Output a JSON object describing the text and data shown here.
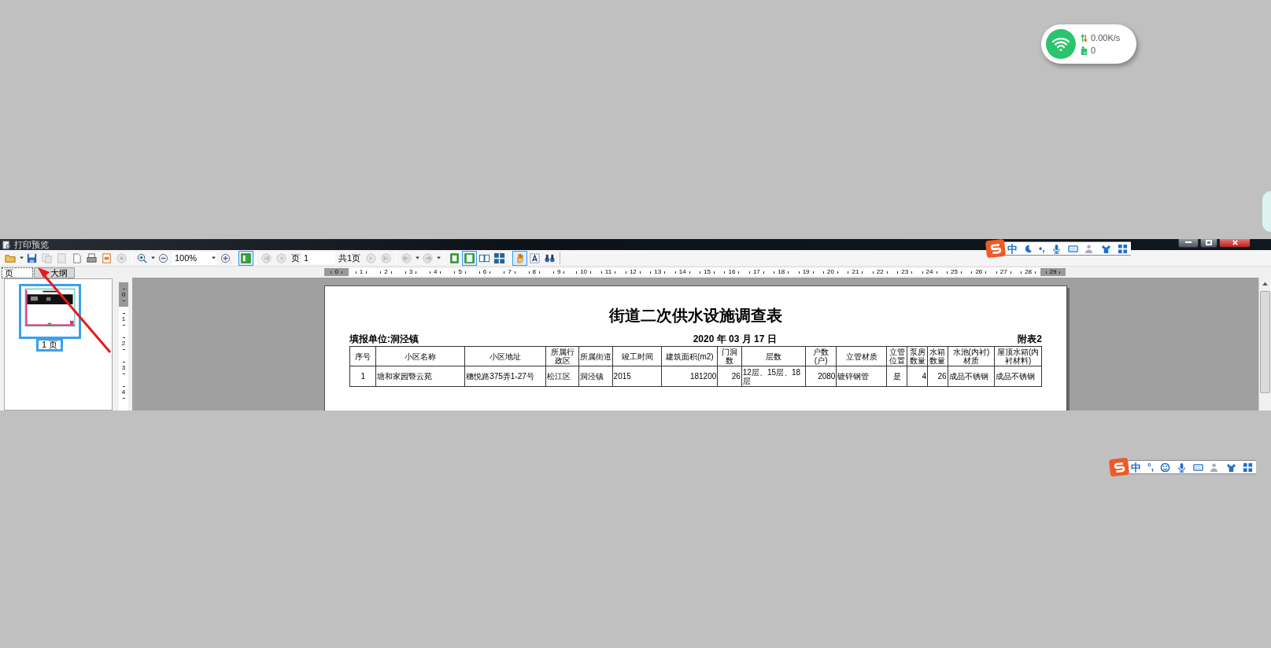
{
  "network_widget": {
    "speed": "0.00K/s",
    "count": "0"
  },
  "window": {
    "title": "打印预览"
  },
  "toolbar": {
    "zoom": "100%",
    "page_label": "页",
    "page_number": "1",
    "page_total": "共1页",
    "thumbnails_on": true,
    "view_modes": [
      {
        "selected": false
      },
      {
        "selected": true
      },
      {
        "selected": false
      },
      {
        "selected": false
      }
    ],
    "tools": [
      {
        "kind": "hand",
        "selected": true
      },
      {
        "kind": "text",
        "selected": false
      },
      {
        "kind": "find",
        "selected": false
      }
    ]
  },
  "side_tabs": [
    {
      "label": "页",
      "selected": true
    },
    {
      "label": "大纲",
      "selected": false
    }
  ],
  "thumbnails": [
    {
      "caption": "1 页",
      "selected": true
    }
  ],
  "ruler": {
    "horizontal": [
      "0",
      "1",
      "2",
      "3",
      "4",
      "5",
      "6",
      "7",
      "8",
      "9",
      "10",
      "11",
      "12",
      "13",
      "14",
      "15",
      "16",
      "17",
      "18",
      "19",
      "20",
      "21",
      "22",
      "23",
      "24",
      "25",
      "26",
      "27",
      "28",
      "29"
    ],
    "vertical": [
      "0",
      "1",
      "2",
      "3",
      "4"
    ]
  },
  "document": {
    "title": "街道二次供水设施调查表",
    "unit": "填报单位:洞泾镇",
    "date": "2020 年 03 月 17 日",
    "appendix": "附表2",
    "columns": [
      "序号",
      "小区名称",
      "小区地址",
      "所属行政区",
      "所属街道",
      "竣工时间",
      "建筑面积(m2)",
      "门洞数",
      "层数",
      "户数(户)",
      "立管材质",
      "立管位置",
      "泵房数量",
      "水箱数量",
      "水池(内衬)材质",
      "屋顶水箱(内衬材料)"
    ],
    "rows": [
      [
        "1",
        "塘和家园暨云苑",
        "穗悦路375弄1-27号",
        "松江区",
        "洞泾镇",
        "2015",
        "181200",
        "26",
        "12层、15层、18层",
        "2080",
        "镀锌钢管",
        "是",
        "4",
        "26",
        "成品不锈钢",
        "成品不锈钢"
      ]
    ]
  },
  "ime_bars": [
    {
      "kind": "compact",
      "mode": "中",
      "punctuation": "•,"
    },
    {
      "kind": "full",
      "mode": "中",
      "punctuation": "°,"
    }
  ]
}
